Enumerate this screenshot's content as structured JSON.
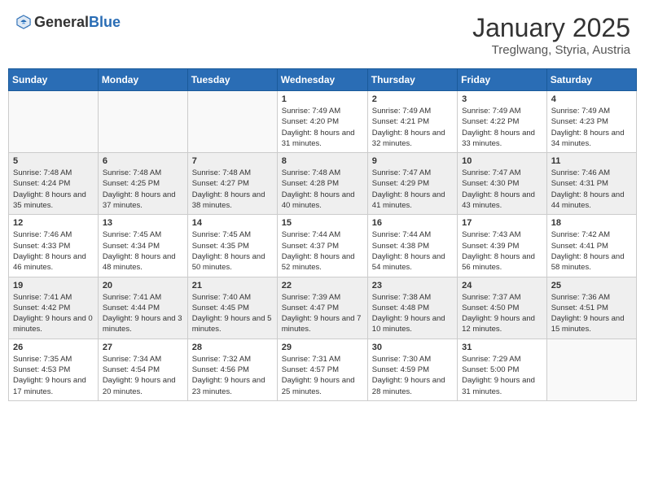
{
  "header": {
    "logo_general": "General",
    "logo_blue": "Blue",
    "month": "January 2025",
    "location": "Treglwang, Styria, Austria"
  },
  "weekdays": [
    "Sunday",
    "Monday",
    "Tuesday",
    "Wednesday",
    "Thursday",
    "Friday",
    "Saturday"
  ],
  "weeks": [
    [
      {
        "day": "",
        "info": ""
      },
      {
        "day": "",
        "info": ""
      },
      {
        "day": "",
        "info": ""
      },
      {
        "day": "1",
        "info": "Sunrise: 7:49 AM\nSunset: 4:20 PM\nDaylight: 8 hours and 31 minutes."
      },
      {
        "day": "2",
        "info": "Sunrise: 7:49 AM\nSunset: 4:21 PM\nDaylight: 8 hours and 32 minutes."
      },
      {
        "day": "3",
        "info": "Sunrise: 7:49 AM\nSunset: 4:22 PM\nDaylight: 8 hours and 33 minutes."
      },
      {
        "day": "4",
        "info": "Sunrise: 7:49 AM\nSunset: 4:23 PM\nDaylight: 8 hours and 34 minutes."
      }
    ],
    [
      {
        "day": "5",
        "info": "Sunrise: 7:48 AM\nSunset: 4:24 PM\nDaylight: 8 hours and 35 minutes."
      },
      {
        "day": "6",
        "info": "Sunrise: 7:48 AM\nSunset: 4:25 PM\nDaylight: 8 hours and 37 minutes."
      },
      {
        "day": "7",
        "info": "Sunrise: 7:48 AM\nSunset: 4:27 PM\nDaylight: 8 hours and 38 minutes."
      },
      {
        "day": "8",
        "info": "Sunrise: 7:48 AM\nSunset: 4:28 PM\nDaylight: 8 hours and 40 minutes."
      },
      {
        "day": "9",
        "info": "Sunrise: 7:47 AM\nSunset: 4:29 PM\nDaylight: 8 hours and 41 minutes."
      },
      {
        "day": "10",
        "info": "Sunrise: 7:47 AM\nSunset: 4:30 PM\nDaylight: 8 hours and 43 minutes."
      },
      {
        "day": "11",
        "info": "Sunrise: 7:46 AM\nSunset: 4:31 PM\nDaylight: 8 hours and 44 minutes."
      }
    ],
    [
      {
        "day": "12",
        "info": "Sunrise: 7:46 AM\nSunset: 4:33 PM\nDaylight: 8 hours and 46 minutes."
      },
      {
        "day": "13",
        "info": "Sunrise: 7:45 AM\nSunset: 4:34 PM\nDaylight: 8 hours and 48 minutes."
      },
      {
        "day": "14",
        "info": "Sunrise: 7:45 AM\nSunset: 4:35 PM\nDaylight: 8 hours and 50 minutes."
      },
      {
        "day": "15",
        "info": "Sunrise: 7:44 AM\nSunset: 4:37 PM\nDaylight: 8 hours and 52 minutes."
      },
      {
        "day": "16",
        "info": "Sunrise: 7:44 AM\nSunset: 4:38 PM\nDaylight: 8 hours and 54 minutes."
      },
      {
        "day": "17",
        "info": "Sunrise: 7:43 AM\nSunset: 4:39 PM\nDaylight: 8 hours and 56 minutes."
      },
      {
        "day": "18",
        "info": "Sunrise: 7:42 AM\nSunset: 4:41 PM\nDaylight: 8 hours and 58 minutes."
      }
    ],
    [
      {
        "day": "19",
        "info": "Sunrise: 7:41 AM\nSunset: 4:42 PM\nDaylight: 9 hours and 0 minutes."
      },
      {
        "day": "20",
        "info": "Sunrise: 7:41 AM\nSunset: 4:44 PM\nDaylight: 9 hours and 3 minutes."
      },
      {
        "day": "21",
        "info": "Sunrise: 7:40 AM\nSunset: 4:45 PM\nDaylight: 9 hours and 5 minutes."
      },
      {
        "day": "22",
        "info": "Sunrise: 7:39 AM\nSunset: 4:47 PM\nDaylight: 9 hours and 7 minutes."
      },
      {
        "day": "23",
        "info": "Sunrise: 7:38 AM\nSunset: 4:48 PM\nDaylight: 9 hours and 10 minutes."
      },
      {
        "day": "24",
        "info": "Sunrise: 7:37 AM\nSunset: 4:50 PM\nDaylight: 9 hours and 12 minutes."
      },
      {
        "day": "25",
        "info": "Sunrise: 7:36 AM\nSunset: 4:51 PM\nDaylight: 9 hours and 15 minutes."
      }
    ],
    [
      {
        "day": "26",
        "info": "Sunrise: 7:35 AM\nSunset: 4:53 PM\nDaylight: 9 hours and 17 minutes."
      },
      {
        "day": "27",
        "info": "Sunrise: 7:34 AM\nSunset: 4:54 PM\nDaylight: 9 hours and 20 minutes."
      },
      {
        "day": "28",
        "info": "Sunrise: 7:32 AM\nSunset: 4:56 PM\nDaylight: 9 hours and 23 minutes."
      },
      {
        "day": "29",
        "info": "Sunrise: 7:31 AM\nSunset: 4:57 PM\nDaylight: 9 hours and 25 minutes."
      },
      {
        "day": "30",
        "info": "Sunrise: 7:30 AM\nSunset: 4:59 PM\nDaylight: 9 hours and 28 minutes."
      },
      {
        "day": "31",
        "info": "Sunrise: 7:29 AM\nSunset: 5:00 PM\nDaylight: 9 hours and 31 minutes."
      },
      {
        "day": "",
        "info": ""
      }
    ]
  ]
}
